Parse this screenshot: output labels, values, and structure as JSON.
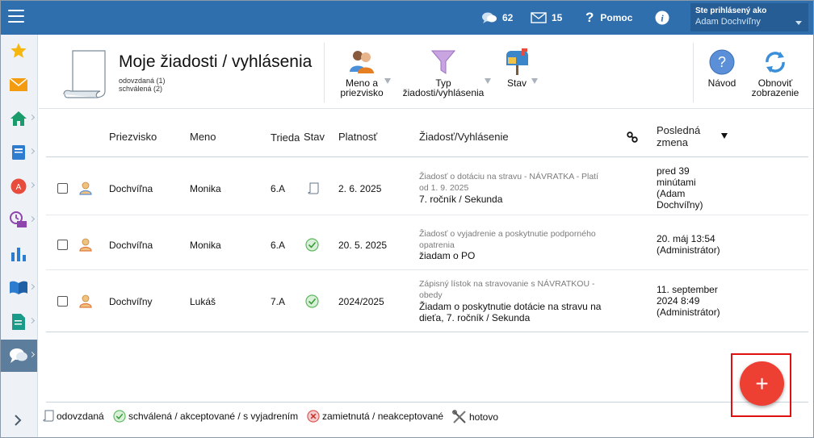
{
  "topbar": {
    "messages_count": "62",
    "mail_count": "15",
    "help_label": "Pomoc",
    "user_label": "Ste prihlásený ako",
    "user_name": "Adam Dochvíľny"
  },
  "header": {
    "title": "Moje žiadosti / vyhlásenia",
    "sub_submitted": "odovzdaná (1)",
    "sub_approved": "schválená (2)",
    "filter_name_l1": "Meno a",
    "filter_name_l2": "priezvisko",
    "filter_type_l1": "Typ",
    "filter_type_l2": "žiadosti/vyhlásenia",
    "filter_state": "Stav",
    "help_l1": "Návod",
    "refresh_l1": "Obnoviť",
    "refresh_l2": "zobrazenie"
  },
  "table": {
    "columns": {
      "surname": "Priezvisko",
      "name": "Meno",
      "class": "Trieda",
      "state": "Stav",
      "validity": "Platnosť",
      "request": "Žiadosť/Vyhlásenie",
      "last_change_l1": "Posledná",
      "last_change_l2": "zmena"
    },
    "rows": [
      {
        "surname": "Dochvíľna",
        "name": "Monika",
        "class": "6.A",
        "validity": "2. 6. 2025",
        "title_l1": "Žiadosť o dotáciu na stravu - NÁVRATKA - Platí",
        "title_l2": "od 1. 9. 2025",
        "text_l1": "7. ročník / Sekunda",
        "text_l2": "",
        "change_l1": "pred 39",
        "change_l2": "minútami",
        "change_l3": "(Adam",
        "change_l4": "Dochvíľny)"
      },
      {
        "surname": "Dochvíľna",
        "name": "Monika",
        "class": "6.A",
        "validity": "20. 5. 2025",
        "title_l1": "Žiadosť o vyjadrenie a poskytnutie podporného",
        "title_l2": "opatrenia",
        "text_l1": "žiadam o PO",
        "text_l2": "",
        "change_l1": "20. máj 13:54",
        "change_l2": "(Administrátor)"
      },
      {
        "surname": "Dochvíľny",
        "name": "Lukáš",
        "class": "7.A",
        "validity": "2024/2025",
        "title_l1": "Zápisný lístok na stravovanie s NÁVRATKOU -",
        "title_l2": "obedy",
        "text_l1": "Žiadam o poskytnutie dotácie na stravu na",
        "text_l2": "dieťa, 7. ročník / Sekunda",
        "change_l1": "11. september",
        "change_l2": "2024 8:49",
        "change_l3": "(Administrátor)"
      }
    ]
  },
  "legend": {
    "submitted": "odovzdaná",
    "approved": "schválená / akceptované / s vyjadrením",
    "rejected": "zamietnutá / neakceptované",
    "done": "hotovo"
  },
  "fab": {
    "label": "+"
  },
  "colors": {
    "topbar": "#2f6fad",
    "sidebar_active": "#5c7d9b",
    "fab": "#ee3f33",
    "highlight_frame": "#e01010",
    "approved": "#5cb85c"
  }
}
